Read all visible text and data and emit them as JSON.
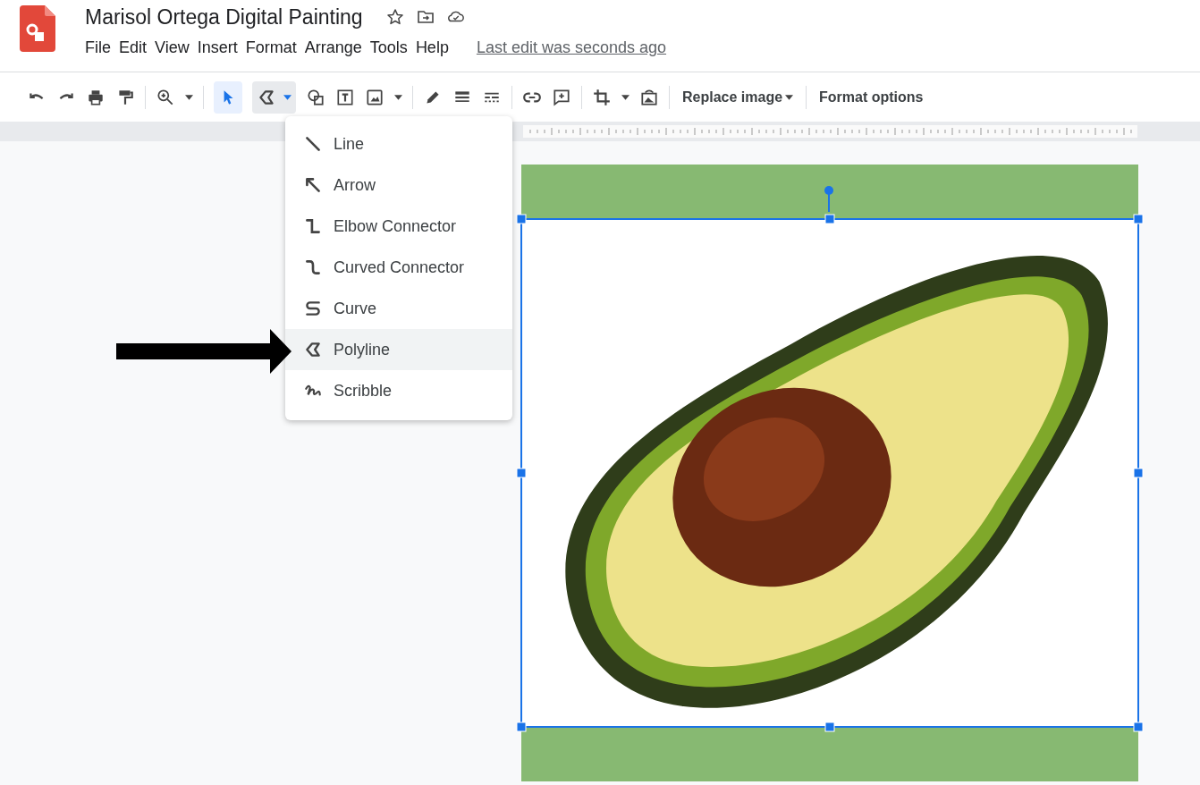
{
  "document": {
    "title": "Marisol Ortega Digital Painting",
    "starred": false
  },
  "menu_bar": [
    "File",
    "Edit",
    "View",
    "Insert",
    "Format",
    "Arrange",
    "Tools",
    "Help"
  ],
  "last_edit": "Last edit was seconds ago",
  "toolbar": {
    "select_tool": {
      "selected": true
    },
    "line_tool": {
      "selected": true
    },
    "text_buttons": [
      {
        "label": "Replace image",
        "dropdown": true
      },
      {
        "label": "Format options",
        "dropdown": false
      }
    ]
  },
  "line_menu": [
    {
      "label": "Line",
      "kind": "line",
      "selected": false
    },
    {
      "label": "Arrow",
      "kind": "arrow",
      "selected": false
    },
    {
      "label": "Elbow Connector",
      "kind": "elbow",
      "selected": false
    },
    {
      "label": "Curved Connector",
      "kind": "curved",
      "selected": false
    },
    {
      "label": "Curve",
      "kind": "curve",
      "selected": false
    },
    {
      "label": "Polyline",
      "kind": "polyline",
      "selected": true
    },
    {
      "label": "Scribble",
      "kind": "scribble",
      "selected": false
    }
  ]
}
